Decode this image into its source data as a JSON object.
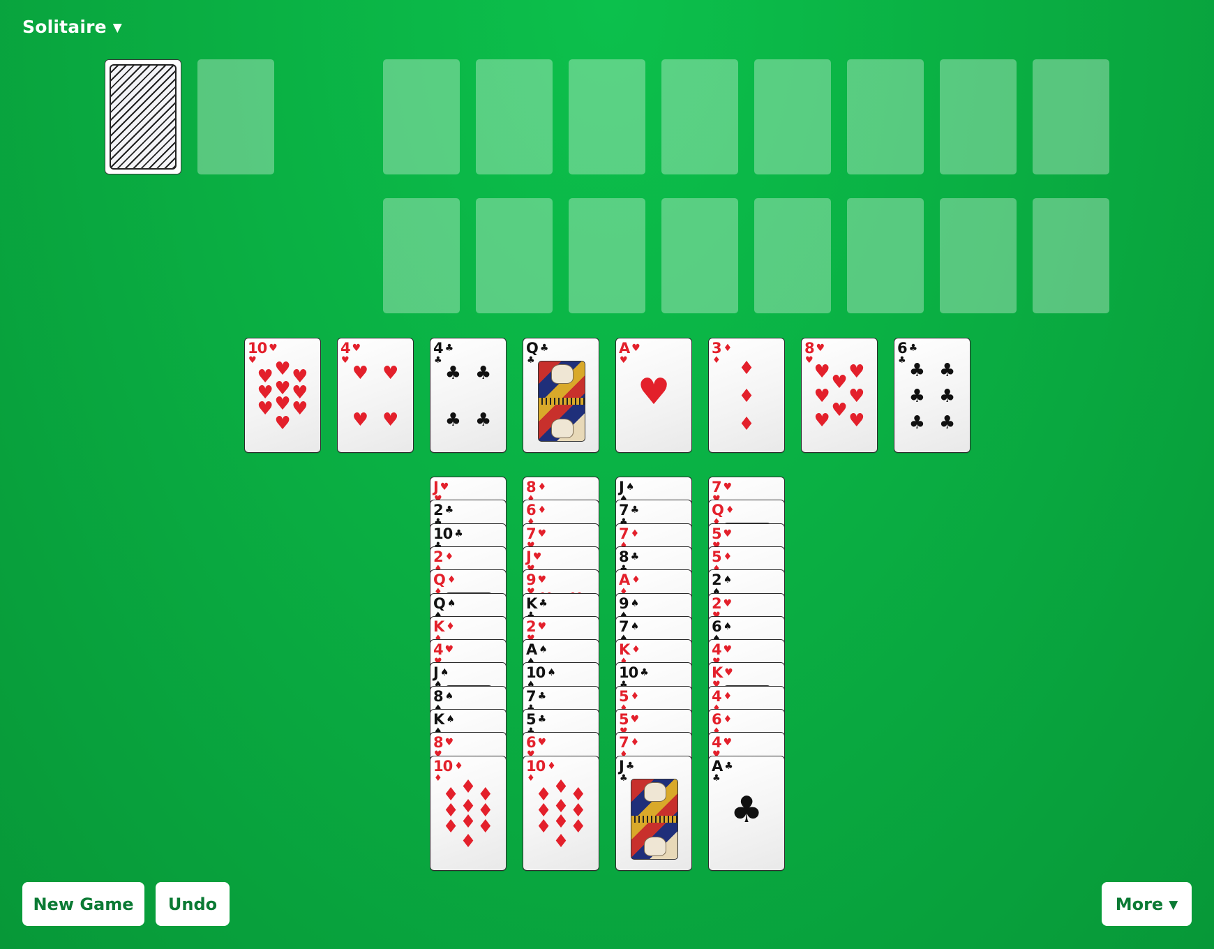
{
  "header": {
    "title": "Solitaire",
    "title_caret": "▼"
  },
  "colors": {
    "felt": "#0aaf43",
    "button_text": "#0b7a34",
    "red_suit": "#e3202b",
    "black_suit": "#111111"
  },
  "suit_glyphs": {
    "hearts": "♥",
    "diamonds": "♦",
    "clubs": "♣",
    "spades": "♠"
  },
  "stock": {
    "state": "face-down",
    "icon": "card-back-icon"
  },
  "waste": {
    "cards": []
  },
  "foundations": {
    "rows": 2,
    "columns": 8,
    "filled": 0
  },
  "reserve": [
    {
      "rank": "10",
      "suit": "hearts"
    },
    {
      "rank": "4",
      "suit": "hearts"
    },
    {
      "rank": "4",
      "suit": "clubs"
    },
    {
      "rank": "Q",
      "suit": "clubs"
    },
    {
      "rank": "A",
      "suit": "hearts"
    },
    {
      "rank": "3",
      "suit": "diamonds"
    },
    {
      "rank": "8",
      "suit": "hearts"
    },
    {
      "rank": "6",
      "suit": "clubs"
    }
  ],
  "tableau": [
    [
      {
        "rank": "J",
        "suit": "hearts"
      },
      {
        "rank": "2",
        "suit": "clubs"
      },
      {
        "rank": "10",
        "suit": "clubs"
      },
      {
        "rank": "2",
        "suit": "diamonds"
      },
      {
        "rank": "Q",
        "suit": "diamonds"
      },
      {
        "rank": "Q",
        "suit": "spades"
      },
      {
        "rank": "K",
        "suit": "diamonds"
      },
      {
        "rank": "4",
        "suit": "hearts"
      },
      {
        "rank": "J",
        "suit": "spades"
      },
      {
        "rank": "8",
        "suit": "spades"
      },
      {
        "rank": "K",
        "suit": "spades"
      },
      {
        "rank": "8",
        "suit": "hearts"
      },
      {
        "rank": "10",
        "suit": "diamonds"
      }
    ],
    [
      {
        "rank": "8",
        "suit": "diamonds"
      },
      {
        "rank": "6",
        "suit": "diamonds"
      },
      {
        "rank": "7",
        "suit": "hearts"
      },
      {
        "rank": "J",
        "suit": "hearts"
      },
      {
        "rank": "9",
        "suit": "hearts"
      },
      {
        "rank": "K",
        "suit": "clubs"
      },
      {
        "rank": "2",
        "suit": "hearts"
      },
      {
        "rank": "A",
        "suit": "spades"
      },
      {
        "rank": "10",
        "suit": "spades"
      },
      {
        "rank": "7",
        "suit": "clubs"
      },
      {
        "rank": "5",
        "suit": "clubs"
      },
      {
        "rank": "6",
        "suit": "hearts"
      },
      {
        "rank": "10",
        "suit": "diamonds"
      }
    ],
    [
      {
        "rank": "J",
        "suit": "spades"
      },
      {
        "rank": "7",
        "suit": "clubs"
      },
      {
        "rank": "7",
        "suit": "diamonds"
      },
      {
        "rank": "8",
        "suit": "clubs"
      },
      {
        "rank": "A",
        "suit": "diamonds"
      },
      {
        "rank": "9",
        "suit": "spades"
      },
      {
        "rank": "7",
        "suit": "spades"
      },
      {
        "rank": "K",
        "suit": "diamonds"
      },
      {
        "rank": "10",
        "suit": "clubs"
      },
      {
        "rank": "5",
        "suit": "diamonds"
      },
      {
        "rank": "5",
        "suit": "hearts"
      },
      {
        "rank": "7",
        "suit": "diamonds"
      },
      {
        "rank": "J",
        "suit": "clubs"
      }
    ],
    [
      {
        "rank": "7",
        "suit": "hearts"
      },
      {
        "rank": "Q",
        "suit": "diamonds"
      },
      {
        "rank": "5",
        "suit": "hearts"
      },
      {
        "rank": "5",
        "suit": "diamonds"
      },
      {
        "rank": "2",
        "suit": "spades"
      },
      {
        "rank": "2",
        "suit": "hearts"
      },
      {
        "rank": "6",
        "suit": "spades"
      },
      {
        "rank": "4",
        "suit": "hearts"
      },
      {
        "rank": "K",
        "suit": "hearts"
      },
      {
        "rank": "4",
        "suit": "diamonds"
      },
      {
        "rank": "6",
        "suit": "diamonds"
      },
      {
        "rank": "4",
        "suit": "hearts"
      },
      {
        "rank": "A",
        "suit": "clubs"
      }
    ]
  ],
  "buttons": {
    "new_game": "New Game",
    "undo": "Undo",
    "more": "More",
    "more_caret": "▼"
  }
}
